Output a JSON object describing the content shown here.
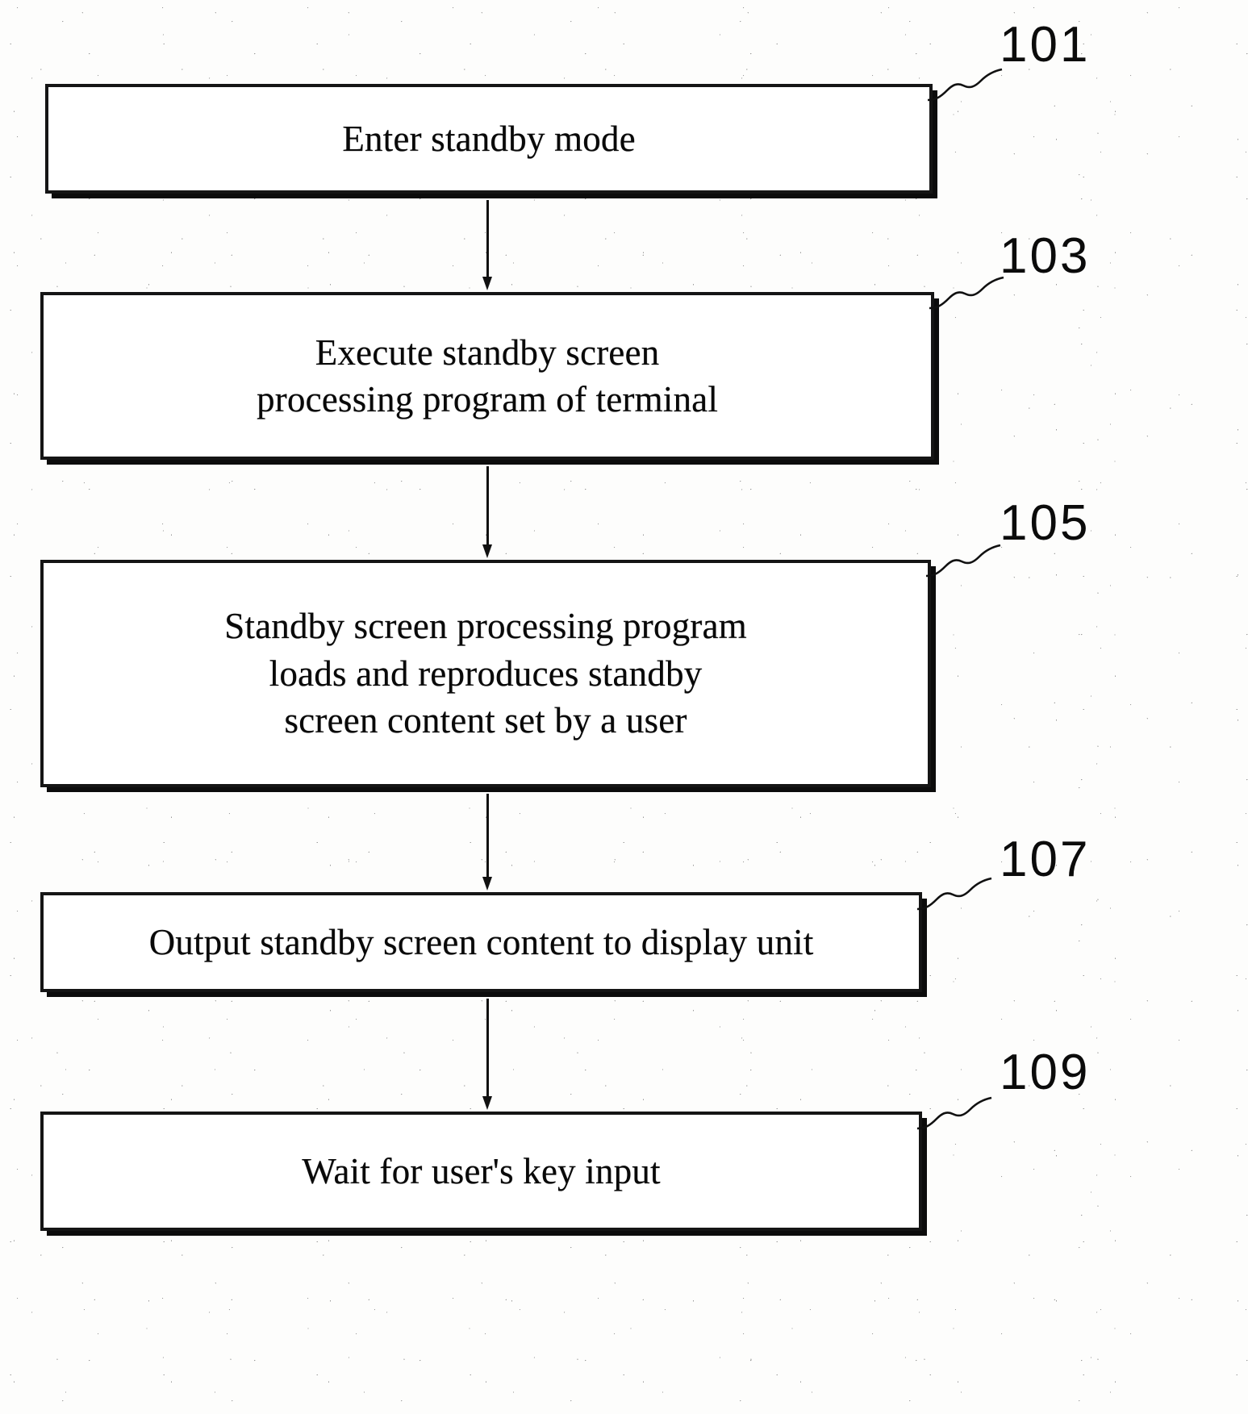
{
  "figure": {
    "type": "patent-flowchart",
    "orientation": "vertical",
    "steps": [
      {
        "ref": "101",
        "label": "Enter standby mode",
        "lines": [
          "Enter standby mode"
        ]
      },
      {
        "ref": "103",
        "label": "Execute standby screen processing program of terminal",
        "lines": [
          "Execute standby screen",
          "processing program of terminal"
        ]
      },
      {
        "ref": "105",
        "label": "Standby screen processing program loads and reproduces standby screen content set by a user",
        "lines": [
          "Standby screen processing program",
          "loads and reproduces standby",
          "screen content set by a user"
        ]
      },
      {
        "ref": "107",
        "label": "Output standby screen content to display unit",
        "lines": [
          "Output standby screen content to display unit"
        ]
      },
      {
        "ref": "109",
        "label": "Wait for user's key input",
        "lines": [
          "Wait for user's key input"
        ]
      }
    ],
    "connectors": [
      {
        "from": "101",
        "to": "103",
        "kind": "arrow-down"
      },
      {
        "from": "103",
        "to": "105",
        "kind": "arrow-down"
      },
      {
        "from": "105",
        "to": "107",
        "kind": "arrow-down"
      },
      {
        "from": "107",
        "to": "109",
        "kind": "arrow-down"
      }
    ],
    "colors": {
      "ink": "#111111",
      "paper": "#fdfdfc"
    }
  },
  "boxes": {
    "b101": {
      "line1": "Enter standby mode"
    },
    "b103": {
      "line1": "Execute standby screen",
      "line2": "processing program of terminal"
    },
    "b105": {
      "line1": "Standby screen processing program",
      "line2": "loads and reproduces standby",
      "line3": "screen content set by a user"
    },
    "b107": {
      "line1": "Output standby screen content to display unit"
    },
    "b109": {
      "line1": "Wait for user's key input"
    }
  },
  "refs": {
    "r101": "101",
    "r103": "103",
    "r105": "105",
    "r107": "107",
    "r109": "109"
  }
}
